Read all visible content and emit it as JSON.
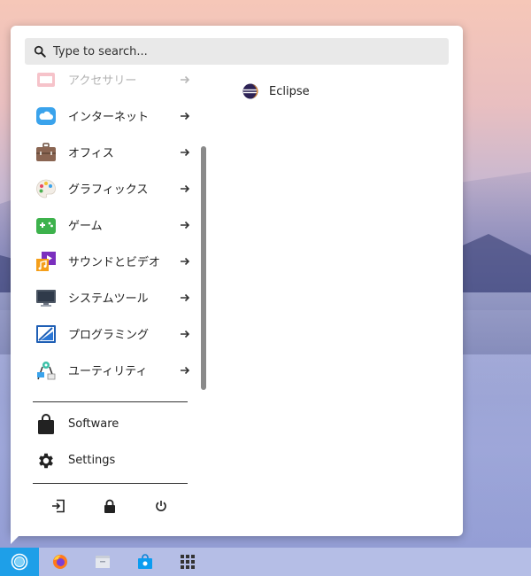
{
  "search": {
    "placeholder": "Type to search..."
  },
  "categories": [
    {
      "label": "アクセサリー",
      "icon": "accessories-icon"
    },
    {
      "label": "インターネット",
      "icon": "cloud-icon"
    },
    {
      "label": "オフィス",
      "icon": "briefcase-icon"
    },
    {
      "label": "グラフィックス",
      "icon": "palette-icon"
    },
    {
      "label": "ゲーム",
      "icon": "gamepad-icon"
    },
    {
      "label": "サウンドとビデオ",
      "icon": "music-icon"
    },
    {
      "label": "システムツール",
      "icon": "monitor-icon"
    },
    {
      "label": "プログラミング",
      "icon": "programming-icon"
    },
    {
      "label": "ユーティリティ",
      "icon": "utilities-icon"
    }
  ],
  "apps": [
    {
      "label": "Eclipse",
      "icon": "eclipse-icon"
    }
  ],
  "favorites": [
    {
      "label": "Software",
      "icon": "shopping-bag-icon"
    },
    {
      "label": "Settings",
      "icon": "gear-icon"
    }
  ],
  "power_actions": [
    "logout-icon",
    "lock-icon",
    "power-icon"
  ],
  "taskbar": [
    "start-menu-icon",
    "firefox-icon",
    "files-icon",
    "software-store-icon",
    "app-grid-icon"
  ],
  "colors": {
    "accent": "#1e9fe8",
    "taskbar": "#b5bee6",
    "menu_bg": "#ffffff"
  }
}
